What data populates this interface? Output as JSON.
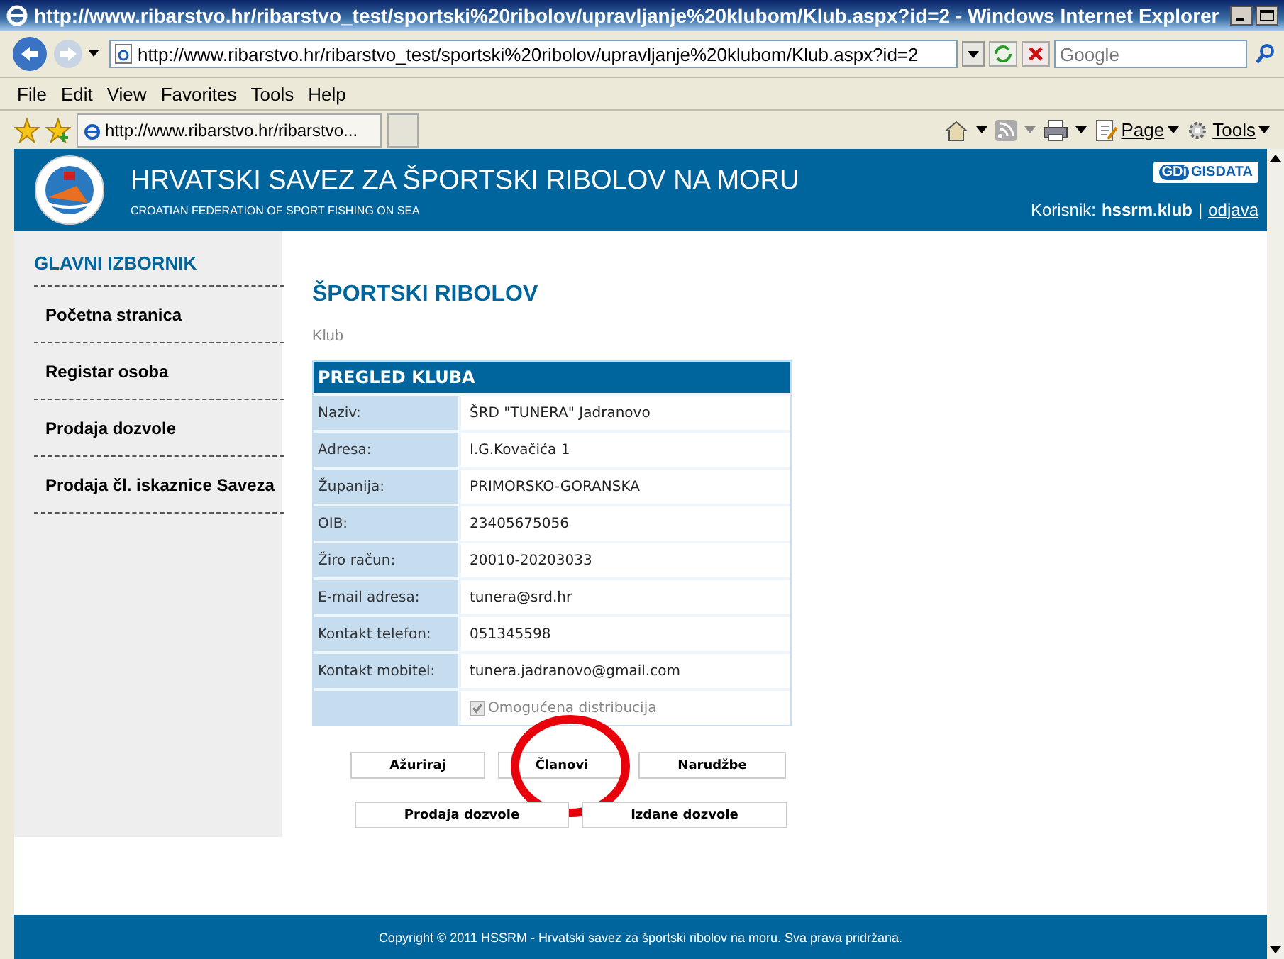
{
  "window": {
    "title": "http://www.ribarstvo.hr/ribarstvo_test/sportski%20ribolov/upravljanje%20klubom/Klub.aspx?id=2 - Windows Internet Explorer"
  },
  "address_bar": {
    "url": "http://www.ribarstvo.hr/ribarstvo_test/sportski%20ribolov/upravljanje%20klubom/Klub.aspx?id=2",
    "search_placeholder": "Google"
  },
  "menu": [
    "File",
    "Edit",
    "View",
    "Favorites",
    "Tools",
    "Help"
  ],
  "tabs": [
    {
      "label": "http://www.ribarstvo.hr/ribarstvo...",
      "selected": true
    }
  ],
  "command_bar": [
    "Page",
    "Tools"
  ],
  "header": {
    "title": "HRVATSKI SAVEZ ZA ŠPORTSKI RIBOLOV NA MORU",
    "subtitle": "CROATIAN FEDERATION OF SPORT FISHING ON SEA",
    "partner_logo": [
      "GDi",
      "GISDATA"
    ],
    "user_label": "Korisnik:",
    "username": "hssrm.klub",
    "separator": "|",
    "logout": "odjava"
  },
  "sidebar": {
    "heading": "GLAVNI IZBORNIK",
    "items": [
      "Početna stranica",
      "Registar osoba",
      "Prodaja dozvole",
      "Prodaja čl. iskaznice Saveza"
    ]
  },
  "content": {
    "title": "ŠPORTSKI RIBOLOV",
    "breadcrumb": "Klub",
    "table": {
      "heading": "PREGLED KLUBA",
      "rows": [
        {
          "label": "Naziv:",
          "value": "ŠRD \"TUNERA\" Jadranovo"
        },
        {
          "label": "Adresa:",
          "value": "I.G.Kovačića 1"
        },
        {
          "label": "Županija:",
          "value": "PRIMORSKO-GORANSKA"
        },
        {
          "label": "OIB:",
          "value": "23405675056"
        },
        {
          "label": "Žiro račun:",
          "value": "20010-20203033"
        },
        {
          "label": "E-mail adresa:",
          "value": "tunera@srd.hr"
        },
        {
          "label": "Kontakt telefon:",
          "value": "051345598"
        },
        {
          "label": "Kontakt mobitel:",
          "value": "tunera.jadranovo@gmail.com"
        }
      ],
      "checkbox": {
        "label": "Omogućena distribucija",
        "checked": true,
        "disabled": true
      }
    },
    "button_rows": [
      [
        {
          "label": "Ažuriraj",
          "circled": false
        },
        {
          "label": "Članovi",
          "circled": true
        },
        {
          "label": "Narudžbe",
          "circled": false
        }
      ],
      [
        {
          "label": "Prodaja dozvole",
          "circled": false
        },
        {
          "label": "Izdane dozvole",
          "circled": false
        }
      ]
    ]
  },
  "footer": "Copyright © 2011 HSSRM - Hrvatski savez za športski ribolov na moru. Sva prava pridržana."
}
